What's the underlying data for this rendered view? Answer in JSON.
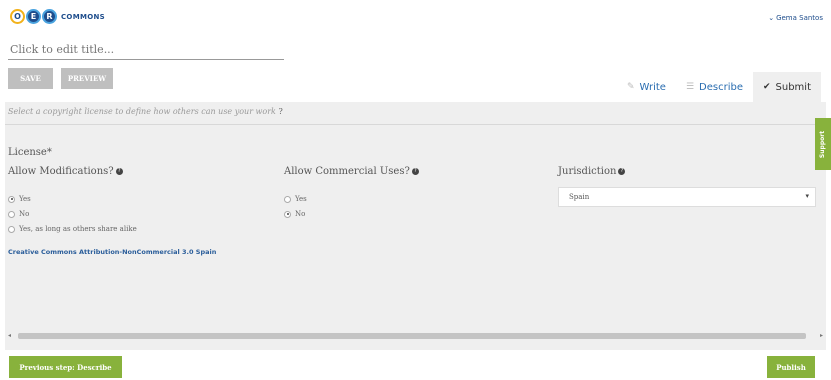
{
  "logo": {
    "letters": [
      "O",
      "E",
      "R"
    ],
    "text": "COMMONS"
  },
  "user": {
    "name": "Gema Santos",
    "chevron": "chevron-down-icon"
  },
  "title": {
    "placeholder": "Click to edit title..."
  },
  "toolbar": {
    "save_label": "SAVE",
    "preview_label": "PREVIEW"
  },
  "tabs": [
    {
      "label": "Write",
      "icon": "pencil-icon",
      "glyph": "✎"
    },
    {
      "label": "Describe",
      "icon": "list-icon",
      "glyph": "☰"
    },
    {
      "label": "Submit",
      "icon": "check-icon",
      "glyph": "✔"
    }
  ],
  "hint": {
    "text": "Select a copyright license to define how others can use your work",
    "glyph": "?"
  },
  "license": {
    "label": "License*",
    "modifications": {
      "heading": "Allow Modifications?",
      "options": [
        "Yes",
        "No",
        "Yes, as long as others share alike"
      ],
      "selected": "Yes"
    },
    "commercial": {
      "heading": "Allow Commercial Uses?",
      "options": [
        "Yes",
        "No"
      ],
      "selected": "No"
    },
    "jurisdiction": {
      "heading": "Jurisdiction",
      "value": "Spain"
    },
    "result": "Creative Commons Attribution-NonCommercial 3.0 Spain"
  },
  "footer": {
    "prev_label": "Previous step: Describe",
    "publish_label": "Publish"
  },
  "support": {
    "label": "Support"
  },
  "colors": {
    "accent_green": "#88b23c",
    "link_blue": "#2a5d9a",
    "panel": "#efefef"
  }
}
